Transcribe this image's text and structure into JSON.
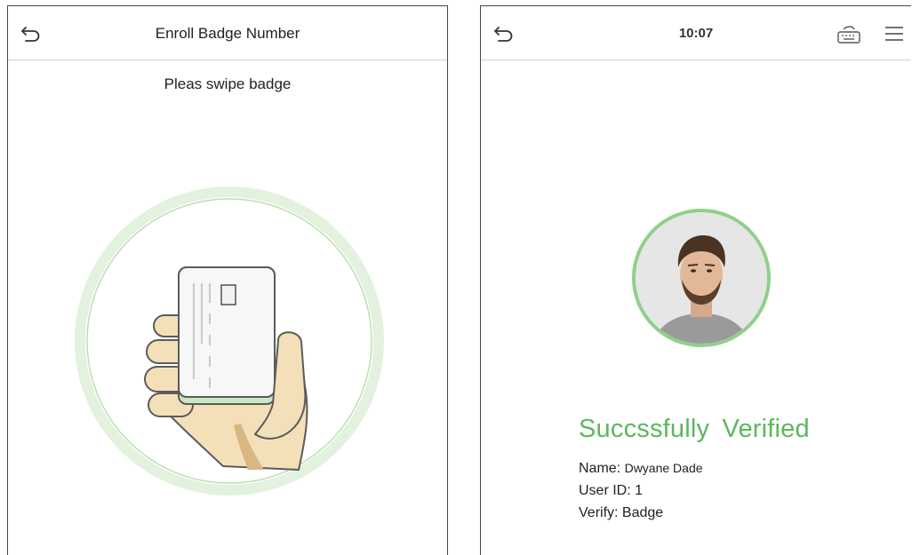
{
  "enroll_screen": {
    "title": "Enroll Badge Number",
    "prompt": "Pleas swipe badge"
  },
  "verify_screen": {
    "time": "10:07",
    "status": "Succssfully  Verified",
    "name_label": "Name:",
    "name_value": "Dwyane Dade",
    "user_id_label": "User ID:",
    "user_id_value": "1",
    "verify_label": "Verify:",
    "verify_value": "Badge"
  },
  "icons": {
    "back": "back-arrow-icon",
    "keyboard": "keyboard-icon",
    "menu": "hamburger-menu-icon",
    "badge": "hand-holding-badge-illustration",
    "avatar": "user-face-photo"
  },
  "colors": {
    "success_green": "#5cb85c",
    "ring_green": "#8fd08a",
    "ring_light": "#e3f1df",
    "card_green": "#c9e8c3",
    "skin": "#f3e0b8",
    "skin_shadow": "#d7b883"
  }
}
